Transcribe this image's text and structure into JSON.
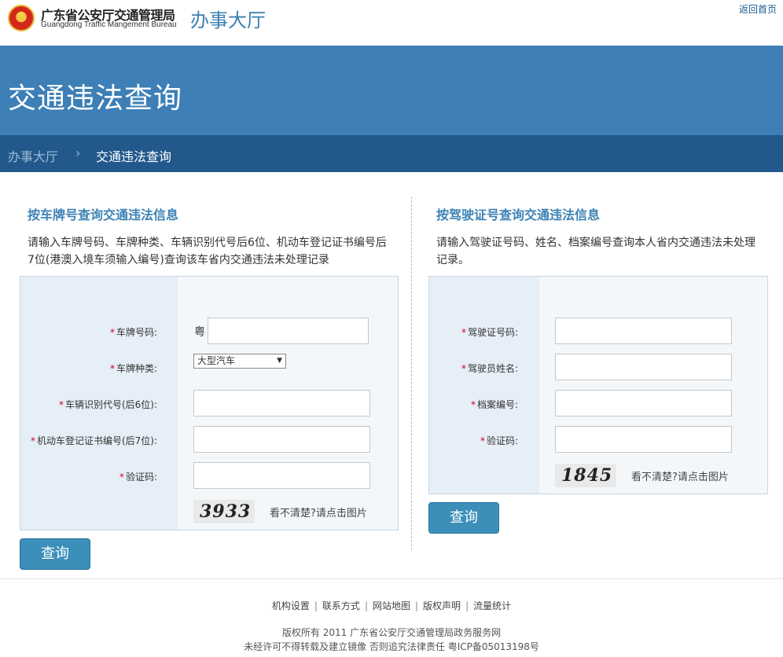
{
  "header": {
    "bureau_cn": "广东省公安厅交通管理局",
    "bureau_en": "Guangdong Traffic Mangement Bureau",
    "site_name": "办事大厅",
    "home_link": "返回首页"
  },
  "banner": {
    "title": "交通违法查询"
  },
  "breadcrumb": {
    "home": "办事大厅",
    "separator": "›",
    "current": "交通违法查询"
  },
  "left_panel": {
    "title": "按车牌号查询交通违法信息",
    "desc_line1": "请输入车牌号码、车牌种类、车辆识别代号后6位、机动车登记证书编号后",
    "desc_line2": "7位(港澳入境车须输入编号)查询该车省内交通违法未处理记录",
    "plate_label": "车牌号码:",
    "plate_prefix": "粤",
    "plate_value": "",
    "type_label": "车牌种类:",
    "type_selected": "大型汽车",
    "vin_label": "车辆识别代号(后6位):",
    "vin_value": "",
    "cert_label": "机动车登记证书编号(后7位):",
    "cert_value": "",
    "captcha_label": "验证码:",
    "captcha_value": "",
    "captcha_text": "3933",
    "captcha_hint": "看不清楚?请点击图片",
    "submit": "查询"
  },
  "right_panel": {
    "title": "按驾驶证号查询交通违法信息",
    "desc_line1": "请输入驾驶证号码、姓名、档案编号查询本人省内交通违法未处理",
    "desc_line2": "记录。",
    "license_label": "驾驶证号码:",
    "license_value": "",
    "name_label": "驾驶员姓名:",
    "name_value": "",
    "file_label": "档案编号:",
    "file_value": "",
    "captcha_label": "验证码:",
    "captcha_value": "",
    "captcha_text": "1845",
    "captcha_hint": "看不清楚?请点击图片",
    "submit": "查询"
  },
  "footer": {
    "links": [
      "机构设置",
      "联系方式",
      "网站地图",
      "版权声明",
      "流量统计"
    ],
    "link_separator": "|",
    "copyright": "版权所有 2011 广东省公安厅交通管理局政务服务网",
    "notice": "未经许可不得转载及建立镜像 否则追究法律责任 粤ICP备05013198号"
  },
  "required_mark": "*",
  "colors": {
    "banner": "#3d7fb6",
    "breadcrumb_bar": "#22588b",
    "accent": "#3c82b4",
    "button": "#3b8fb9"
  }
}
